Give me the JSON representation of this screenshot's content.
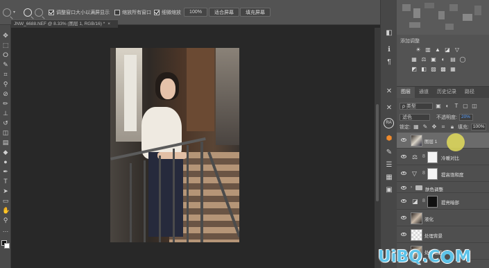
{
  "options_bar": {
    "resize_windows_label": "调整窗口大小以满屏显示",
    "zoom_all_windows_label": "缩放所有窗口",
    "scrubby_zoom_label": "细微缩放",
    "zoom_value": "100%",
    "fit_screen_label": "适合屏幕",
    "fill_screen_label": "填充屏幕",
    "resize_windows_checked": true,
    "zoom_all_windows_checked": false,
    "scrubby_zoom_checked": true
  },
  "document": {
    "tab_title": "JNW_6688.NEF @ 8.33% (图层 1, RGB/16) *",
    "close_label": "×"
  },
  "icon_strip": {
    "ra_label": "RA"
  },
  "adjustments_panel": {
    "title": "添加调整",
    "row1": [
      "☀",
      "▥",
      "▲",
      "◪",
      "▽"
    ],
    "row2": [
      "▦",
      "⚖",
      "▣",
      "◐",
      "▤",
      "◯"
    ],
    "row3": [
      "◩",
      "◧",
      "▨",
      "▩",
      "▦"
    ]
  },
  "layers_panel": {
    "tabs": [
      "图层",
      "通道",
      "历史记录",
      "路径"
    ],
    "active_tab": "图层",
    "filter_label": "ρ 类型",
    "blend_mode": "滤色",
    "opacity_label": "不透明度:",
    "opacity_value": "20%",
    "lock_label": "锁定:",
    "fill_label": "填充:",
    "fill_value": "100%",
    "layers": [
      {
        "name": "图层 1",
        "kind": "pixel",
        "selected": true
      },
      {
        "name": "冷暖对比",
        "kind": "adjustment",
        "selected": false
      },
      {
        "name": "提高饱和度",
        "kind": "adjustment",
        "selected": false
      },
      {
        "name": "肤色调整",
        "kind": "group",
        "selected": false
      },
      {
        "name": "提亮暗部",
        "kind": "adjustment",
        "selected": false
      },
      {
        "name": "液化",
        "kind": "pixel",
        "selected": false
      },
      {
        "name": "处理背景",
        "kind": "pixel",
        "selected": false
      },
      {
        "name": "处理瑕疵",
        "kind": "pixel",
        "selected": false
      }
    ]
  },
  "watermark": {
    "text_left": "UiBQ.C",
    "text_right": "M"
  },
  "colors": {
    "app_bg": "#282828",
    "panel_bg": "#535353",
    "selected_layer": "#6b6b6b",
    "accent_blue": "#5aa0ff",
    "watermark": "#5ec3e8"
  }
}
